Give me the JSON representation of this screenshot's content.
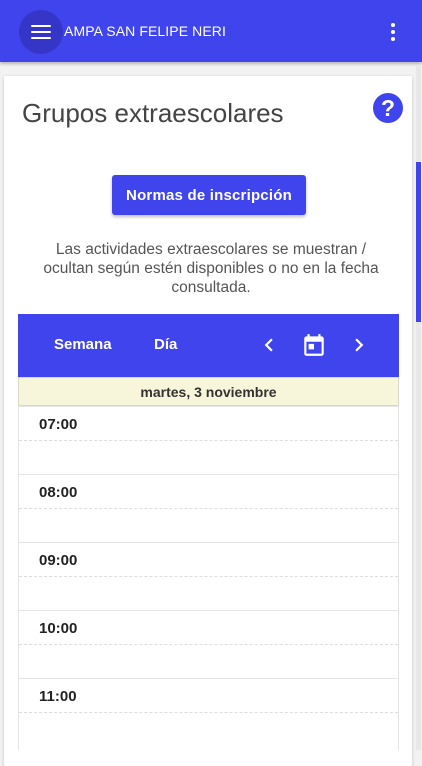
{
  "appbar": {
    "title": "AMPA SAN FELIPE NERI",
    "menu_icon": "hamburger-menu-icon",
    "more_icon": "more-vert-icon",
    "color": "#4044ec"
  },
  "page": {
    "title": "Grupos extraescolares",
    "help_label": "?",
    "rules_button": "Normas de inscripción",
    "info_text": "Las actividades extraescolares se muestran / ocultan según estén disponibles o no en la fecha consultada."
  },
  "calendar": {
    "views": [
      "Semana",
      "Día"
    ],
    "prev_icon": "chevron-left-icon",
    "today_icon": "calendar-today-icon",
    "next_icon": "chevron-right-icon",
    "date_label": "martes, 3 noviembre",
    "header_bg": "#f7f5da",
    "time_slots": [
      "07:00",
      "08:00",
      "09:00",
      "10:00",
      "11:00"
    ]
  }
}
